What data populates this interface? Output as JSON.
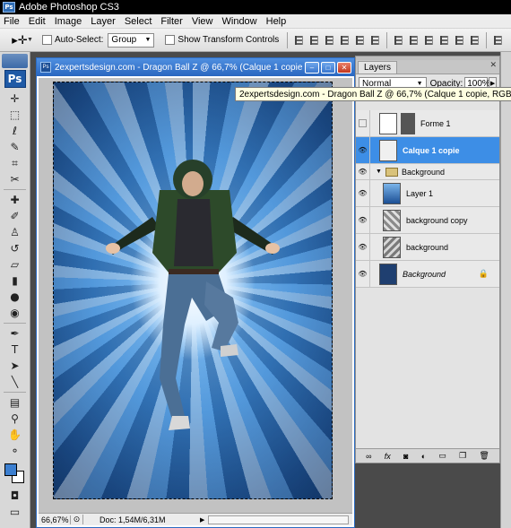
{
  "app": {
    "title": "Adobe Photoshop CS3",
    "logo": "Ps"
  },
  "menu": [
    "File",
    "Edit",
    "Image",
    "Layer",
    "Select",
    "Filter",
    "View",
    "Window",
    "Help"
  ],
  "options": {
    "auto_select_label": "Auto-Select:",
    "auto_select_value": "Group",
    "transform_label": "Show Transform Controls"
  },
  "document": {
    "title": "2expertsdesign.com - Dragon Ball Z @ 66,7% (Calque 1 copie, RGB/8)",
    "zoom": "66,67%",
    "doc_size": "Doc: 1,54M/6,31M"
  },
  "tooltip": "2expertsdesign.com - Dragon Ball Z @ 66,7% (Calque 1 copie, RGB/8)",
  "layers_panel": {
    "tab": "Layers",
    "blend_mode": "Normal",
    "opacity_label": "Opacity:",
    "opacity_value": "100%",
    "layers": [
      {
        "name": "Forme 1",
        "visible": false,
        "thumb": "white-shape"
      },
      {
        "name": "Calque 1 copie",
        "visible": true,
        "selected": true,
        "thumb": "figure"
      },
      {
        "name": "Background",
        "visible": true,
        "type": "group"
      },
      {
        "name": "Layer 1",
        "visible": true,
        "thumb": "blue"
      },
      {
        "name": "background copy",
        "visible": true,
        "thumb": "texture"
      },
      {
        "name": "background",
        "visible": true,
        "thumb": "texture"
      },
      {
        "name": "Background",
        "visible": true,
        "locked": true,
        "thumb": "dark-blue"
      }
    ]
  },
  "colors": {
    "foreground": "#3c7fd0",
    "background": "#ffffff",
    "selection": "#3d8ee6"
  }
}
